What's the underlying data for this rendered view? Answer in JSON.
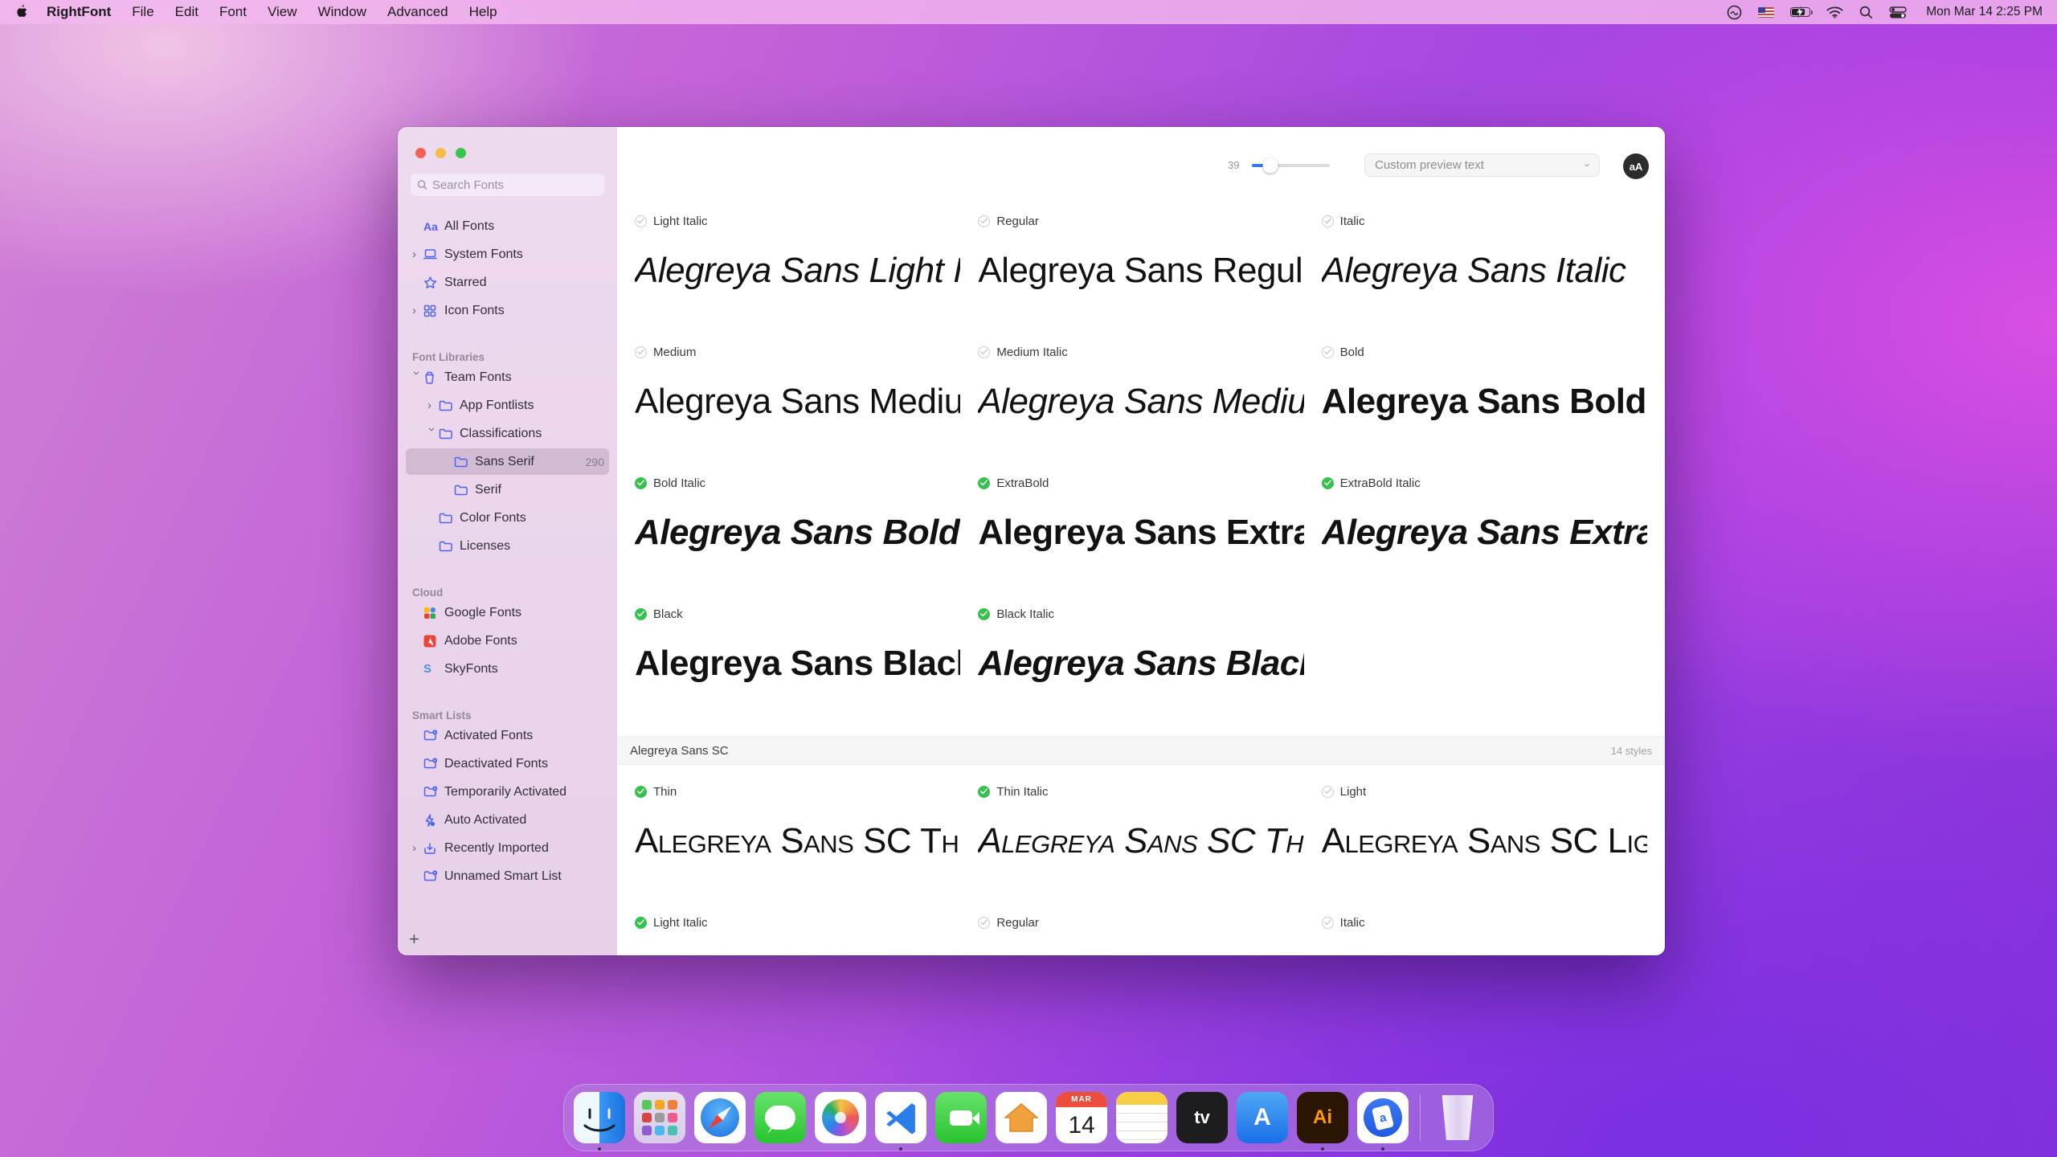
{
  "menu_bar": {
    "app_name": "RightFont",
    "menus": [
      "File",
      "Edit",
      "Font",
      "View",
      "Window",
      "Advanced",
      "Help"
    ],
    "status_icons": [
      "creative-cloud",
      "input-source-flag",
      "battery-charging",
      "wifi",
      "spotlight-search",
      "control-center"
    ],
    "clock": "Mon Mar 14 2:25 PM"
  },
  "window": {
    "sidebar": {
      "search_placeholder": "Search Fonts",
      "top_items": [
        {
          "label": "All Fonts",
          "icon": "aa-icon",
          "chevron": null,
          "indent": 0
        },
        {
          "label": "System Fonts",
          "icon": "laptop-icon",
          "chevron": "right",
          "indent": 0
        },
        {
          "label": "Starred",
          "icon": "star-icon",
          "chevron": null,
          "indent": 0
        },
        {
          "label": "Icon Fonts",
          "icon": "grid-icon",
          "chevron": "right",
          "indent": 0
        }
      ],
      "sections": [
        {
          "title": "Font Libraries",
          "items": [
            {
              "label": "Team Fonts",
              "icon": "bucket-icon",
              "chevron": "down",
              "indent": 0
            },
            {
              "label": "App Fontlists",
              "icon": "folder-icon",
              "chevron": "right",
              "indent": 1
            },
            {
              "label": "Classifications",
              "icon": "folder-icon",
              "chevron": "down",
              "indent": 1
            },
            {
              "label": "Sans Serif",
              "icon": "folder-icon",
              "chevron": null,
              "indent": 2,
              "count": "290",
              "selected": true
            },
            {
              "label": "Serif",
              "icon": "folder-icon",
              "chevron": null,
              "indent": 2
            },
            {
              "label": "Color Fonts",
              "icon": "folder-icon",
              "chevron": null,
              "indent": 1
            },
            {
              "label": "Licenses",
              "icon": "folder-icon",
              "chevron": null,
              "indent": 1
            }
          ]
        },
        {
          "title": "Cloud",
          "items": [
            {
              "label": "Google Fonts",
              "icon": "google-fonts-icon",
              "chevron": null,
              "indent": 0
            },
            {
              "label": "Adobe Fonts",
              "icon": "adobe-fonts-icon",
              "chevron": null,
              "indent": 0
            },
            {
              "label": "SkyFonts",
              "icon": "skyfonts-icon",
              "chevron": null,
              "indent": 0
            }
          ]
        },
        {
          "title": "Smart Lists",
          "items": [
            {
              "label": "Activated Fonts",
              "icon": "folder-badge-icon",
              "chevron": null,
              "indent": 0
            },
            {
              "label": "Deactivated Fonts",
              "icon": "folder-badge-icon",
              "chevron": null,
              "indent": 0
            },
            {
              "label": "Temporarily Activated",
              "icon": "folder-badge-icon",
              "chevron": null,
              "indent": 0
            },
            {
              "label": "Auto Activated",
              "icon": "bolt-icon",
              "chevron": null,
              "indent": 0
            },
            {
              "label": "Recently Imported",
              "icon": "import-icon",
              "chevron": "right",
              "indent": 0
            },
            {
              "label": "Unnamed Smart List",
              "icon": "folder-badge-icon",
              "chevron": null,
              "indent": 0
            }
          ]
        }
      ],
      "add_button": "+"
    },
    "toolbar": {
      "size_value": "39",
      "slider_percent": 24,
      "preview_dropdown_label": "Custom preview text",
      "aa_button": "aA"
    },
    "font_grid": {
      "families": [
        {
          "name": null,
          "styles": [
            {
              "label": "Light Italic",
              "activated": false,
              "preview": "Alegreya Sans Light Italic",
              "weight": 300,
              "italic": true
            },
            {
              "label": "Regular",
              "activated": false,
              "preview": "Alegreya Sans Regular",
              "weight": 400,
              "italic": false
            },
            {
              "label": "Italic",
              "activated": false,
              "preview": "Alegreya Sans Italic",
              "weight": 400,
              "italic": true
            },
            {
              "label": "Medium",
              "activated": false,
              "preview": "Alegreya Sans Medium",
              "weight": 500,
              "italic": false
            },
            {
              "label": "Medium Italic",
              "activated": false,
              "preview": "Alegreya Sans Medium Italic",
              "weight": 500,
              "italic": true
            },
            {
              "label": "Bold",
              "activated": false,
              "preview": "Alegreya Sans Bold",
              "weight": 700,
              "italic": false
            },
            {
              "label": "Bold Italic",
              "activated": true,
              "preview": "Alegreya Sans Bold Italic",
              "weight": 700,
              "italic": true
            },
            {
              "label": "ExtraBold",
              "activated": true,
              "preview": "Alegreya Sans ExtraBold",
              "weight": 800,
              "italic": false
            },
            {
              "label": "ExtraBold Italic",
              "activated": true,
              "preview": "Alegreya Sans ExtraBold Italic",
              "weight": 800,
              "italic": true
            },
            {
              "label": "Black",
              "activated": true,
              "preview": "Alegreya Sans Black",
              "weight": 900,
              "italic": false
            },
            {
              "label": "Black Italic",
              "activated": true,
              "preview": "Alegreya Sans Black Italic",
              "weight": 900,
              "italic": true
            }
          ]
        },
        {
          "name": "Alegreya Sans SC",
          "count_label": "14 styles",
          "smallcaps": true,
          "styles": [
            {
              "label": "Thin",
              "activated": true,
              "preview": "Alegreya Sans SC Thin",
              "weight": 200,
              "italic": false
            },
            {
              "label": "Thin Italic",
              "activated": true,
              "preview": "Alegreya Sans SC Thin Italic",
              "weight": 200,
              "italic": true
            },
            {
              "label": "Light",
              "activated": false,
              "preview": "Alegreya Sans SC Light",
              "weight": 300,
              "italic": false
            },
            {
              "label": "Light Italic",
              "activated": true,
              "preview": null,
              "weight": 300,
              "italic": true
            },
            {
              "label": "Regular",
              "activated": false,
              "preview": null,
              "weight": 400,
              "italic": false
            },
            {
              "label": "Italic",
              "activated": false,
              "preview": null,
              "weight": 400,
              "italic": true
            }
          ]
        }
      ]
    }
  },
  "dock": {
    "items": [
      {
        "id": "finder",
        "running": true
      },
      {
        "id": "launchpad",
        "running": false
      },
      {
        "id": "safari",
        "running": false
      },
      {
        "id": "messages",
        "running": false
      },
      {
        "id": "photos",
        "running": false
      },
      {
        "id": "vscode",
        "running": true
      },
      {
        "id": "facetime",
        "running": false
      },
      {
        "id": "home",
        "running": false
      },
      {
        "id": "calendar",
        "running": false,
        "month": "MAR",
        "day": "14"
      },
      {
        "id": "notes",
        "running": false
      },
      {
        "id": "appletv",
        "running": false,
        "label": "tv"
      },
      {
        "id": "appstore",
        "running": false,
        "label": "A"
      },
      {
        "id": "illustrator",
        "running": true,
        "label": "Ai"
      },
      {
        "id": "rightfont",
        "running": true,
        "label": "a"
      },
      {
        "id": "divider"
      },
      {
        "id": "trash",
        "running": false
      }
    ]
  },
  "colors": {
    "activated_green": "#34c24c",
    "accent_blue": "#3478f6",
    "sidebar_icon_blue": "#4f63f2"
  }
}
